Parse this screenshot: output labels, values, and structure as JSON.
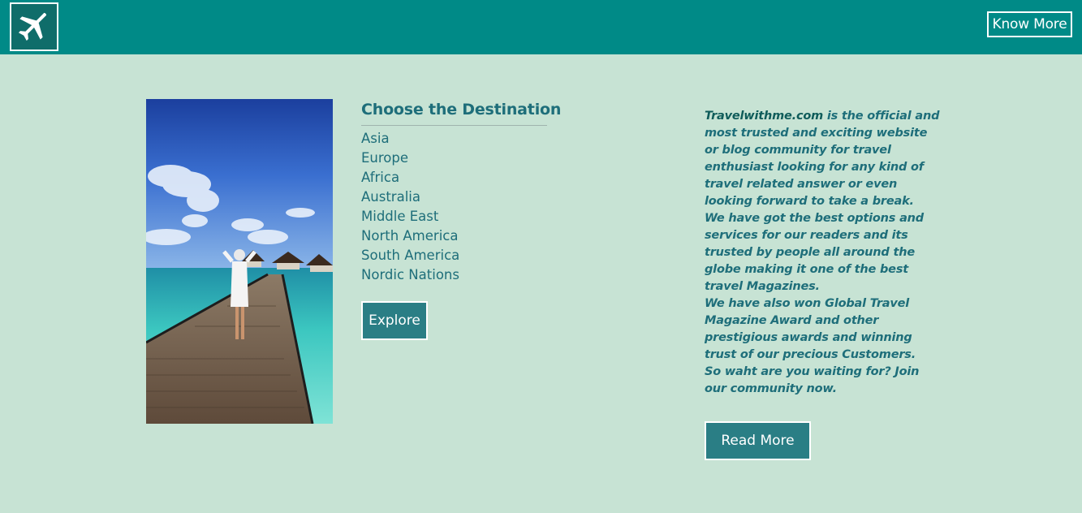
{
  "header": {
    "logo_icon": "airplane-icon",
    "know_more_label": "Know More",
    "bg_color": "#008a87"
  },
  "destinations": {
    "title": "Choose the Destination",
    "items": [
      "Asia",
      "Europe",
      "Africa",
      "Australia",
      "Middle East",
      "North America",
      "South America",
      "Nordic Nations"
    ],
    "explore_label": "Explore"
  },
  "about": {
    "brand": "Travelwithme.com",
    "intro_rest": " is the official and most trusted and exciting website or blog community for travel enthusiast looking for any kind of travel related answer or even looking forward to take a break.",
    "paragraph2": "We have got the best options and services for our readers and its trusted by people all around the globe making it one of the best travel Magazines.",
    "paragraph3": "We have also won Global Travel Magazine Award and other prestigious awards and winning trust of our precious Customers.",
    "paragraph4": "So waht are you waiting for? Join our community now.",
    "read_more_label": "Read More"
  },
  "colors": {
    "page_bg": "#c7e3d4",
    "accent_text": "#1e6e7a",
    "button_bg": "#2a7e85"
  }
}
